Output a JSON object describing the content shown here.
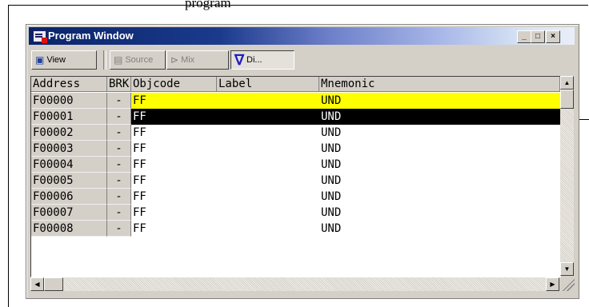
{
  "caption": "program",
  "window": {
    "title": "Program Window",
    "controls": [
      "_",
      "□",
      "×"
    ]
  },
  "toolbar": {
    "view_label": "View",
    "source_label": "Source",
    "mix_label": "Mix",
    "disasm_label": "Di..."
  },
  "columns": [
    "Address",
    "BRK",
    "Objcode",
    "Label",
    "Mnemonic"
  ],
  "rows": [
    {
      "address": "F00000",
      "brk": "-",
      "objcode": "FF",
      "label": "",
      "mnemonic": "UND",
      "highlight": "yellow"
    },
    {
      "address": "F00001",
      "brk": "-",
      "objcode": "FF",
      "label": "",
      "mnemonic": "UND",
      "highlight": "black"
    },
    {
      "address": "F00002",
      "brk": "-",
      "objcode": "FF",
      "label": "",
      "mnemonic": "UND",
      "highlight": ""
    },
    {
      "address": "F00003",
      "brk": "-",
      "objcode": "FF",
      "label": "",
      "mnemonic": "UND",
      "highlight": ""
    },
    {
      "address": "F00004",
      "brk": "-",
      "objcode": "FF",
      "label": "",
      "mnemonic": "UND",
      "highlight": ""
    },
    {
      "address": "F00005",
      "brk": "-",
      "objcode": "FF",
      "label": "",
      "mnemonic": "UND",
      "highlight": ""
    },
    {
      "address": "F00006",
      "brk": "-",
      "objcode": "FF",
      "label": "",
      "mnemonic": "UND",
      "highlight": ""
    },
    {
      "address": "F00007",
      "brk": "-",
      "objcode": "FF",
      "label": "",
      "mnemonic": "UND",
      "highlight": ""
    },
    {
      "address": "F00008",
      "brk": "-",
      "objcode": "FF",
      "label": "",
      "mnemonic": "UND",
      "highlight": ""
    }
  ],
  "colors": {
    "highlight_yellow": "#ffff00",
    "highlight_black": "#000000",
    "title_gradient_start": "#0a246a"
  }
}
